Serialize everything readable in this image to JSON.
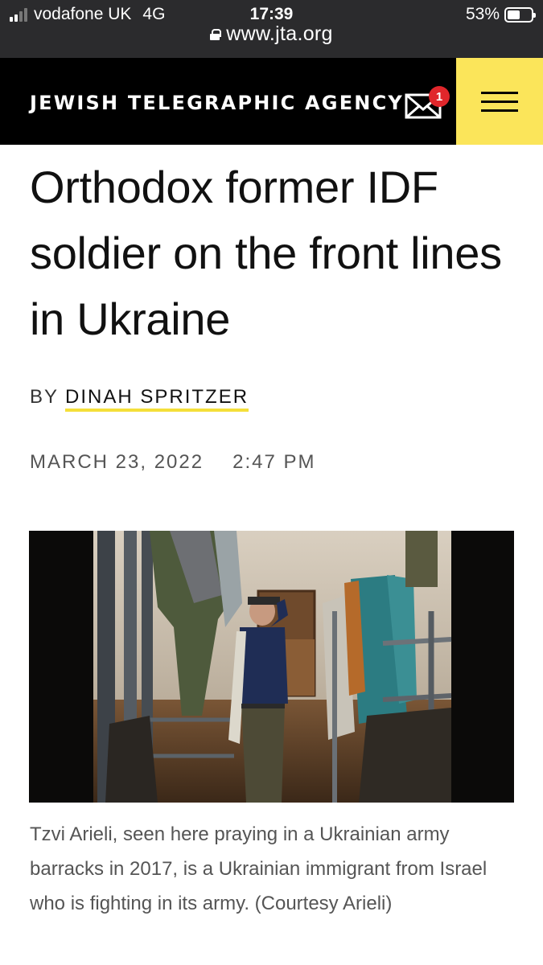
{
  "status_bar": {
    "carrier": "vodafone UK",
    "network": "4G",
    "time": "17:39",
    "battery": "53%",
    "battery_level": 0.53,
    "url": "www.jta.org"
  },
  "header": {
    "brand": "JEWISH TELEGRAPHIC AGENCY",
    "mail_badge": "1",
    "icons": [
      "mail-icon",
      "menu-icon"
    ],
    "accent": "#fbe55a"
  },
  "article": {
    "headline": "Orthodox former IDF soldier on the front lines in Ukraine",
    "byline_prefix": "BY",
    "author": "DINAH SPRITZER",
    "date": "MARCH 23, 2022",
    "time": "2:47 PM",
    "caption": "Tzvi Arieli, seen here praying in a Ukrainian army barracks in 2017, is a Ukrainian immigrant from Israel who is fighting in its army. (Courtesy Arieli)"
  }
}
